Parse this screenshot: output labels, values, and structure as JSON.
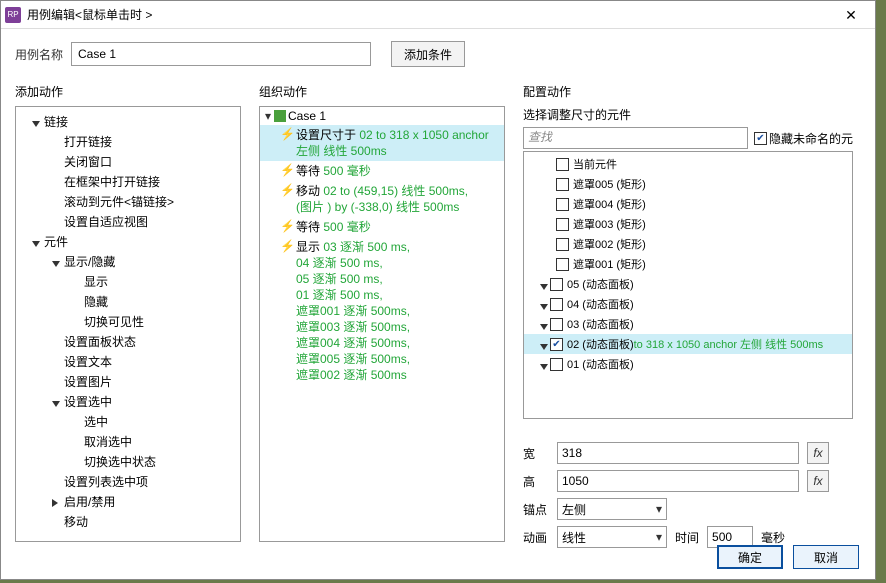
{
  "title": "用例编辑<鼠标单击时 >",
  "labels": {
    "caseName": "用例名称",
    "addCondition": "添加条件",
    "addAction": "添加动作",
    "orgAction": "组织动作",
    "cfgAction": "配置动作",
    "selectResize": "选择调整尺寸的元件",
    "searchPh": "查找",
    "hideUnnamed": "隐藏未命名的元",
    "width": "宽",
    "height": "高",
    "anchor": "锚点",
    "anim": "动画",
    "time": "时间",
    "msUnit": "毫秒",
    "ok": "确定",
    "cancel": "取消"
  },
  "caseNameVal": "Case 1",
  "addTree": [
    {
      "t": "链接",
      "c": "open",
      "l": 1
    },
    {
      "t": "打开链接",
      "c": "none",
      "l": 2
    },
    {
      "t": "关闭窗口",
      "c": "none",
      "l": 2
    },
    {
      "t": "在框架中打开链接",
      "c": "none",
      "l": 2
    },
    {
      "t": "滚动到元件<锚链接>",
      "c": "none",
      "l": 2
    },
    {
      "t": "设置自适应视图",
      "c": "none",
      "l": 2
    },
    {
      "t": "元件",
      "c": "open",
      "l": 1
    },
    {
      "t": "显示/隐藏",
      "c": "open",
      "l": 2
    },
    {
      "t": "显示",
      "c": "none",
      "l": 3
    },
    {
      "t": "隐藏",
      "c": "none",
      "l": 3
    },
    {
      "t": "切换可见性",
      "c": "none",
      "l": 3
    },
    {
      "t": "设置面板状态",
      "c": "none",
      "l": 2
    },
    {
      "t": "设置文本",
      "c": "none",
      "l": 2
    },
    {
      "t": "设置图片",
      "c": "none",
      "l": 2
    },
    {
      "t": "设置选中",
      "c": "open",
      "l": 2
    },
    {
      "t": "选中",
      "c": "none",
      "l": 3
    },
    {
      "t": "取消选中",
      "c": "none",
      "l": 3
    },
    {
      "t": "切换选中状态",
      "c": "none",
      "l": 3
    },
    {
      "t": "设置列表选中项",
      "c": "none",
      "l": 2
    },
    {
      "t": "启用/禁用",
      "c": "closed",
      "l": 2
    },
    {
      "t": "移动",
      "c": "none",
      "l": 2
    }
  ],
  "orgCase": "Case 1",
  "orgRows": [
    {
      "bolt": true,
      "sel": true,
      "pre": "设置尺寸于 ",
      "grn": "02 to 318 x 1050 anchor 左侧 线性 500ms"
    },
    {
      "bolt": true,
      "pre": "等待 ",
      "grn": "500 毫秒"
    },
    {
      "bolt": true,
      "pre": "移动 ",
      "grn": "02 to (459,15) 线性 500ms,",
      "grn2": "(图片 ) by (-338,0) 线性 500ms"
    },
    {
      "bolt": true,
      "pre": "等待 ",
      "grn": "500 毫秒"
    },
    {
      "bolt": true,
      "pre": "显示 ",
      "grn": "03 逐渐 500 ms,",
      "tail": [
        "04 逐渐 500 ms,",
        "05 逐渐 500 ms,",
        "01 逐渐 500 ms,",
        "遮罩001 逐渐 500ms,",
        "遮罩003 逐渐 500ms,",
        "遮罩004 逐渐 500ms,",
        "遮罩005 逐渐 500ms,",
        "遮罩002 逐渐 500ms"
      ]
    }
  ],
  "cfgTree1": [
    {
      "t": "当前元件"
    },
    {
      "t": "遮罩005 (矩形)"
    },
    {
      "t": "遮罩004 (矩形)"
    },
    {
      "t": "遮罩003 (矩形)"
    },
    {
      "t": "遮罩002 (矩形)"
    },
    {
      "t": "遮罩001 (矩形)"
    }
  ],
  "cfgTree2": [
    {
      "t": "05 (动态面板)",
      "c": "open"
    },
    {
      "t": "04 (动态面板)",
      "c": "open"
    },
    {
      "t": "03 (动态面板)",
      "c": "open"
    },
    {
      "t": "02 (动态面板)",
      "c": "open",
      "sel": true,
      "checked": true,
      "ext": " to 318 x 1050 anchor 左侧 线性 500ms"
    },
    {
      "t": "01 (动态面板)",
      "c": "open"
    }
  ],
  "cfgFields": {
    "w": "318",
    "h": "1050",
    "anchor": "左侧",
    "anim": "线性",
    "time": "500"
  }
}
